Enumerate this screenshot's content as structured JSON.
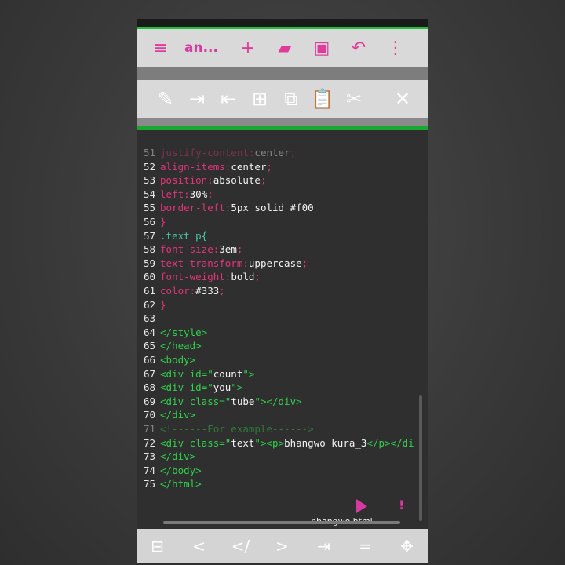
{
  "toolbar_top": {
    "title": "an...",
    "icons": [
      "menu-icon",
      "add-icon",
      "folder-icon",
      "save-icon",
      "undo-icon",
      "more-icon"
    ],
    "icon_glyphs": {
      "menu": "≡",
      "add": "+",
      "folder": "▰",
      "save": "▣",
      "undo": "↶",
      "more": "⋮"
    }
  },
  "toolbar_edit": {
    "icon_glyphs": {
      "edit": "✎",
      "indent": "⇥",
      "outdent": "⇤",
      "select_all": "⊞",
      "copy": "⧉",
      "paste": "📋",
      "cut": "✂",
      "close": "✕"
    }
  },
  "code": {
    "lines": [
      {
        "n": "51",
        "parts": [
          [
            "prop",
            "justify-content:"
          ],
          [
            "val",
            "center"
          ],
          [
            "prop",
            ";"
          ]
        ],
        "ghost": true
      },
      {
        "n": "52",
        "parts": [
          [
            "prop",
            "align-items:"
          ],
          [
            "val",
            "center"
          ],
          [
            "prop",
            ";"
          ]
        ]
      },
      {
        "n": "53",
        "parts": [
          [
            "prop",
            "position:"
          ],
          [
            "val",
            "absolute"
          ],
          [
            "prop",
            ";"
          ]
        ]
      },
      {
        "n": "54",
        "parts": [
          [
            "prop",
            "left:"
          ],
          [
            "val",
            "30%"
          ],
          [
            "prop",
            ";"
          ]
        ]
      },
      {
        "n": "55",
        "parts": [
          [
            "prop",
            "border-left:"
          ],
          [
            "val",
            "5px solid #f00"
          ]
        ]
      },
      {
        "n": "56",
        "parts": [
          [
            "prop",
            "}"
          ]
        ]
      },
      {
        "n": "57",
        "parts": [
          [
            "sel",
            ".text p{"
          ]
        ]
      },
      {
        "n": "58",
        "parts": [
          [
            "prop",
            "font-size:"
          ],
          [
            "val",
            "3em"
          ],
          [
            "prop",
            ";"
          ]
        ]
      },
      {
        "n": "59",
        "parts": [
          [
            "prop",
            "text-transform:"
          ],
          [
            "val",
            "uppercase"
          ],
          [
            "prop",
            ";"
          ]
        ]
      },
      {
        "n": "60",
        "parts": [
          [
            "prop",
            "font-weight:"
          ],
          [
            "val",
            "bold"
          ],
          [
            "prop",
            ";"
          ]
        ]
      },
      {
        "n": "61",
        "parts": [
          [
            "prop",
            "color:"
          ],
          [
            "val",
            "#333"
          ],
          [
            "prop",
            ";"
          ]
        ]
      },
      {
        "n": "62",
        "parts": [
          [
            "prop",
            "}"
          ]
        ]
      },
      {
        "n": "63",
        "parts": []
      },
      {
        "n": "64",
        "parts": [
          [
            "tag",
            "</style>"
          ]
        ]
      },
      {
        "n": "65",
        "parts": [
          [
            "tag",
            "</head>"
          ]
        ]
      },
      {
        "n": "66",
        "parts": [
          [
            "tag",
            "<body>"
          ]
        ]
      },
      {
        "n": "67",
        "parts": [
          [
            "tag",
            "<div id=\""
          ],
          [
            "str",
            "count"
          ],
          [
            "tag",
            "\">"
          ]
        ]
      },
      {
        "n": "68",
        "parts": [
          [
            "tag",
            "<div id=\""
          ],
          [
            "str",
            "you"
          ],
          [
            "tag",
            "\">"
          ]
        ]
      },
      {
        "n": "69",
        "parts": [
          [
            "tag",
            "<div class=\""
          ],
          [
            "str",
            "tube"
          ],
          [
            "tag",
            "\"></div>"
          ]
        ]
      },
      {
        "n": "70",
        "parts": [
          [
            "tag",
            "</div>"
          ]
        ]
      },
      {
        "n": "71",
        "parts": [
          [
            "tag",
            "<!------For example------>"
          ]
        ],
        "ghost": true
      },
      {
        "n": "72",
        "parts": [
          [
            "tag",
            "<div class=\""
          ],
          [
            "str",
            "text"
          ],
          [
            "tag",
            "\"><p>"
          ],
          [
            "val",
            "bhangwo kura_3"
          ],
          [
            "tag",
            "</p></di"
          ]
        ]
      },
      {
        "n": "73",
        "parts": [
          [
            "tag",
            "</div>"
          ]
        ]
      },
      {
        "n": "74",
        "parts": [
          [
            "tag",
            "</body>"
          ]
        ]
      },
      {
        "n": "75",
        "parts": [
          [
            "tag",
            "</html>"
          ]
        ]
      }
    ]
  },
  "file": {
    "name": "bhangwo.html"
  },
  "bottom_bar": {
    "keys": [
      {
        "name": "keyboard-toggle-button",
        "label": "⊟"
      },
      {
        "name": "less-than-key",
        "label": "<"
      },
      {
        "name": "close-tag-key",
        "label": "</"
      },
      {
        "name": "greater-than-key",
        "label": ">"
      },
      {
        "name": "tab-key",
        "label": "⇥"
      },
      {
        "name": "equals-key",
        "label": "="
      },
      {
        "name": "move-cursor-key",
        "label": "✥"
      }
    ]
  },
  "colors": {
    "accent": "#d63aa0",
    "green": "#1fbf3a",
    "property": "#e0357a",
    "tag": "#2fd04a",
    "selector": "#4ec3a8"
  }
}
